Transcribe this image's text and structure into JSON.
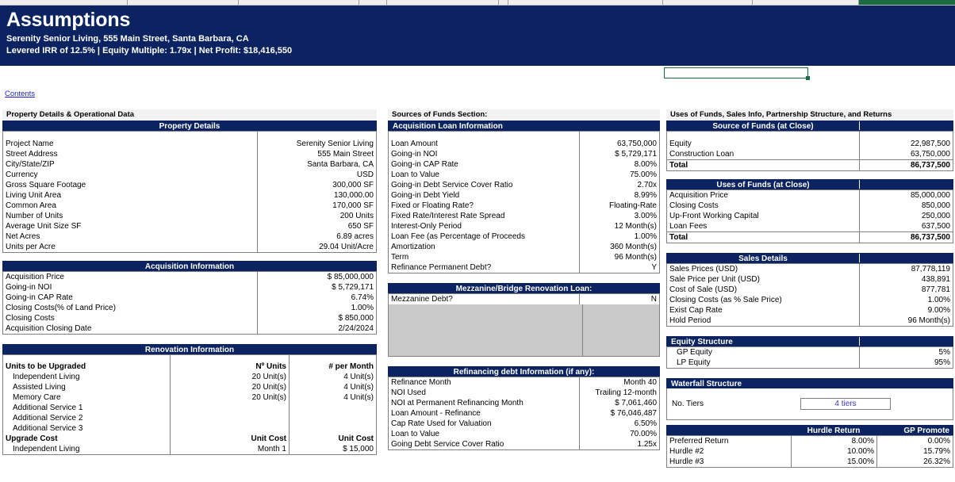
{
  "colstrip": {
    "selected_col_color": "#1d6b42"
  },
  "banner": {
    "title": "Assumptions",
    "subtitle1": "Serenity Senior Living, 555 Main Street, Santa Barbara, CA",
    "subtitle2": "Levered IRR of 12.5% | Equity Multiple: 1.79x | Net Profit: $18,416,550",
    "bg_color": "#0b2360"
  },
  "contents_link": "Contents",
  "left_column": {
    "section_label": "Property Details & Operational Data",
    "property_details": {
      "header": "Property Details",
      "rows": [
        {
          "label": "Project Name",
          "value": "Serenity Senior Living",
          "style": "inp"
        },
        {
          "label": "Street Address",
          "value": "555 Main Street",
          "style": "inp"
        },
        {
          "label": "City/State/ZIP",
          "value": "Santa Barbara, CA",
          "style": "inp"
        },
        {
          "label": "Currency",
          "value": "USD",
          "style": "inp"
        },
        {
          "label": "Gross Square Footage",
          "value": "300,000 SF",
          "style": "calc"
        },
        {
          "label": "Living Unit Area",
          "value": "130,000.00",
          "style": "calc"
        },
        {
          "label": "Common Area",
          "value": "170,000 SF",
          "style": "inp"
        },
        {
          "label": "Number of  Units",
          "value": "200 Units",
          "style": "calc"
        },
        {
          "label": "Average Unit Size SF",
          "value": "650 SF",
          "style": "calc"
        },
        {
          "label": "Net Acres",
          "value": "6.89 acres",
          "style": "calc"
        },
        {
          "label": "Units per Acre",
          "value": "29.04 Unit/Acre",
          "style": "calc"
        }
      ]
    },
    "acquisition_information": {
      "header": "Acquisition Information",
      "rows": [
        {
          "label": "Acquisition Price",
          "value": "$ 85,000,000",
          "style": "inp"
        },
        {
          "label": "Going-in NOI",
          "value": "$ 5,729,171",
          "style": "calc"
        },
        {
          "label": "Going-in CAP Rate",
          "value": "6.74%",
          "style": "calc"
        },
        {
          "label": "Closing Costs(% of Land Price)",
          "value": "1.00%",
          "style": "inp"
        },
        {
          "label": "Closing Costs",
          "value": "$ 850,000",
          "style": "calc"
        },
        {
          "label": "Acquisition Closing Date",
          "value": "2/24/2024",
          "style": "inp"
        }
      ]
    },
    "renovation_information": {
      "header": "Renovation Information",
      "units_header": {
        "label": "Units to be Upgraded",
        "col1": "Nº Units",
        "col2": "# per Month"
      },
      "unit_rows": [
        {
          "label": "Independent Living",
          "col1": "20 Unit(s)",
          "col2": "4 Unit(s)"
        },
        {
          "label": "Assisted Living",
          "col1": "20 Unit(s)",
          "col2": "4 Unit(s)"
        },
        {
          "label": "Memory Care",
          "col1": "20 Unit(s)",
          "col2": "4 Unit(s)"
        },
        {
          "label": "Additional Service 1",
          "col1": "",
          "col2": ""
        },
        {
          "label": "Additional Service 2",
          "col1": "",
          "col2": ""
        },
        {
          "label": "Additional Service 3",
          "col1": "",
          "col2": ""
        }
      ],
      "cost_header": {
        "label": "Upgrade Cost",
        "col1": "Unit Cost",
        "col2": "Unit Cost"
      },
      "cost_rows": [
        {
          "label": "Independent Living",
          "col1": "Month 1",
          "col2": "$ 15,000"
        }
      ]
    }
  },
  "middle_column": {
    "section_label": "Sources of Funds Section:",
    "acquisition_loan": {
      "header": "Acquisition Loan Information",
      "rows": [
        {
          "label": "Loan Amount",
          "value": "63,750,000",
          "style": "calc"
        },
        {
          "label": "Going-in NOI",
          "value": "$ 5,729,171",
          "style": "calc"
        },
        {
          "label": "Going-in CAP Rate",
          "value": "8.00%",
          "style": "inp"
        },
        {
          "label": "Loan to Value",
          "value": "75.00%",
          "style": "inp"
        },
        {
          "label": "Going-in Debt Service Cover Ratio",
          "value": "2.70x",
          "style": "calc"
        },
        {
          "label": "Going-in Debt Yield",
          "value": "8.99%",
          "style": "calc"
        },
        {
          "label": "Fixed or Floating Rate?",
          "value": "Floating-Rate",
          "style": "inp"
        },
        {
          "label": "Fixed Rate/Interest Rate Spread",
          "value": "3.00%",
          "style": "inp"
        },
        {
          "label": "Interest-Only Period",
          "value": "12 Month(s)",
          "style": "inp"
        },
        {
          "label": "Loan Fee (as Percentage of Proceeds",
          "value": "1.00%",
          "style": "inp"
        },
        {
          "label": "Amortization",
          "value": "360 Month(s)",
          "style": "inp"
        },
        {
          "label": "Term",
          "value": "96 Month(s)",
          "style": "inp"
        },
        {
          "label": "Refinance Permanent Debt?",
          "value": "Y",
          "style": "inp"
        }
      ]
    },
    "mezzanine": {
      "header": "Mezzanine/Bridge Renovation Loan:",
      "rows": [
        {
          "label": "Mezzanine Debt?",
          "value": "N",
          "style": "inp"
        }
      ]
    },
    "refinancing": {
      "header": "Refinancing debt Information (if any):",
      "rows": [
        {
          "label": "Refinance Month",
          "value": "Month 40",
          "style": "inp"
        },
        {
          "label": "NOI Used",
          "value": "Trailing 12-month",
          "style": "inp"
        },
        {
          "label": "NOI at Permanent Refinancing Month",
          "value": "$ 7,061,460",
          "style": "calc"
        },
        {
          "label": "Loan Amount - Refinance",
          "value": "$ 76,046,487",
          "style": "calc"
        },
        {
          "label": "Cap Rate Used for Valuation",
          "value": "6.50%",
          "style": "inp"
        },
        {
          "label": "Loan to Value",
          "value": "70.00%",
          "style": "inp"
        },
        {
          "label": "Going Debt Service Cover Ratio",
          "value": "1.25x",
          "style": "calc"
        }
      ]
    }
  },
  "right_column": {
    "section_label": "Uses of Funds, Sales Info, Partnership Structure, and Returns",
    "source_of_funds": {
      "header": "Source of Funds (at Close)",
      "rows": [
        {
          "label": "Equity",
          "value": "22,987,500"
        },
        {
          "label": "Construction Loan",
          "value": "63,750,000"
        }
      ],
      "total": {
        "label": "Total",
        "value": "86,737,500"
      }
    },
    "uses_of_funds": {
      "header": "Uses of Funds (at Close)",
      "rows": [
        {
          "label": "Acquisition Price",
          "value": "85,000,000"
        },
        {
          "label": "Closing Costs",
          "value": "850,000"
        },
        {
          "label": "Up-Front Working Capital",
          "value": "250,000"
        },
        {
          "label": "Loan Fees",
          "value": "637,500"
        }
      ],
      "total": {
        "label": "Total",
        "value": "86,737,500"
      }
    },
    "sales_details": {
      "header": "Sales Details",
      "rows": [
        {
          "label": "Sales Prices (USD)",
          "value": "87,778,119",
          "style": "calc"
        },
        {
          "label": "Sale Price per Unit (USD)",
          "value": "438,891",
          "style": "calc"
        },
        {
          "label": "Cost of Sale (USD)",
          "value": "877,781",
          "style": "calc"
        },
        {
          "label": "Closing Costs (as % Sale Price)",
          "value": "1.00%",
          "style": "inp"
        },
        {
          "label": "Exist Cap Rate",
          "value": "9.00%",
          "style": "inp"
        },
        {
          "label": "Hold Period",
          "value": "96 Month(s)",
          "style": "inp"
        }
      ]
    },
    "equity_structure": {
      "header": "Equity Structure",
      "rows": [
        {
          "label": "GP Equity",
          "value": "5%",
          "style": "inp"
        },
        {
          "label": "LP Equity",
          "value": "95%",
          "style": "calc"
        }
      ]
    },
    "waterfall_structure": {
      "header": "Waterfall Structure",
      "tiers_label": "No. Tiers",
      "tiers_value": "4 tiers",
      "table_header": {
        "col1": "",
        "col2": "Hurdle Return",
        "col3": "GP Promote"
      },
      "rows": [
        {
          "label": "Preferred Return",
          "hurdle": "8.00%",
          "promote": "0.00%"
        },
        {
          "label": "Hurdle #2",
          "hurdle": "10.00%",
          "promote": "15.79%"
        },
        {
          "label": "Hurdle #3",
          "hurdle": "15.00%",
          "promote": "26.32%"
        }
      ]
    }
  }
}
